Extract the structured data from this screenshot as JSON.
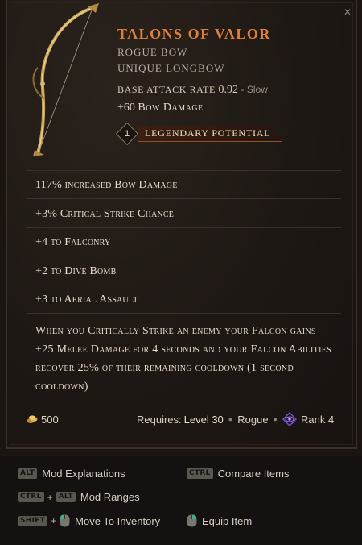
{
  "item": {
    "name": "Talons of Valor",
    "type": "Rogue Bow",
    "subtype": "Unique Longbow",
    "base_stat_label": "Base Attack Rate",
    "base_stat_value": "0.92",
    "base_stat_speed": "- Slow",
    "implicit_value": "+60",
    "implicit_text": "Bow Damage",
    "legendary_potential_count": "1",
    "legendary_potential_label": "Legendary Potential",
    "affixes": [
      "117% increased Bow Damage",
      "+3% Critical Strike Chance",
      "+4 to Falconry",
      "+2 to Dive Bomb",
      "+3 to Aerial Assault"
    ],
    "unique_effect": "When you Critically Strike an enemy your Falcon gains +25 Melee Damage for 4 seconds and your Falcon Abilities recover 25% of their remaining cooldown (1 second cooldown)",
    "gold_value": "500",
    "requires_label": "Requires:",
    "requires_level": "Level 30",
    "requires_class": "Rogue",
    "rank": "Rank 4"
  },
  "controls": {
    "alt_key": "ALT",
    "ctrl_key": "CTRL",
    "shift_key": "SHIFT",
    "plus": "+",
    "mod_explanations": "Mod Explanations",
    "compare_items": "Compare Items",
    "mod_ranges": "Mod Ranges",
    "move_to_inventory": "Move To Inventory",
    "equip_item": "Equip Item"
  },
  "icons": {
    "close": "close-icon",
    "bow": "bow-icon",
    "gold": "gold-coin-icon",
    "rank": "rank-eye-icon",
    "mouse_left": "mouse-left-click-icon",
    "mouse_right": "mouse-right-click-icon"
  },
  "colors": {
    "item_name": "#e07f3c",
    "legendary_accent": "#9a4f20",
    "rank_icon": "#7b4fd0"
  }
}
